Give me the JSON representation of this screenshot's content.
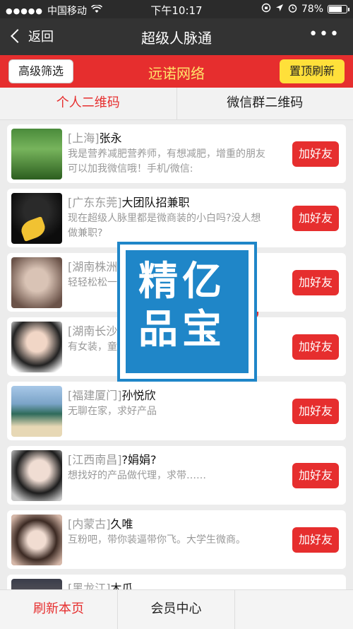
{
  "status_bar": {
    "carrier": "中国移动",
    "time": "下午10:17",
    "battery_percent": "78%",
    "battery_level": 0.78
  },
  "nav": {
    "back_label": "返回",
    "title": "超级人脉通",
    "more_label": "•••"
  },
  "header": {
    "filter_label": "高级筛选",
    "title": "远诺网络",
    "top_refresh_label": "置顶刷新"
  },
  "tabs": [
    {
      "label": "个人二维码",
      "active": true
    },
    {
      "label": "微信群二维码",
      "active": false
    }
  ],
  "list": {
    "add_label": "加好友",
    "items": [
      {
        "location": "[上海]",
        "name": "张永",
        "desc": "我是营养减肥营养师，有想减肥，增重的朋友可以加我微信哦！手机/微信:"
      },
      {
        "location": "[广东东莞]",
        "name": "大团队招兼职",
        "desc": "现在超级人脉里都是微商装的小白吗?没人想做兼职?"
      },
      {
        "location": "[湖南株洲",
        "name": "",
        "desc": "轻轻松松一"
      },
      {
        "location": "[湖南长沙",
        "name": "",
        "desc": "有女装，童"
      },
      {
        "location": "[福建厦门]",
        "name": "孙悦欣",
        "desc": "无聊在家，求好产品"
      },
      {
        "location": "[江西南昌]",
        "name": "?娟娟?",
        "desc": "想找好的产品做代理，求带……"
      },
      {
        "location": "[内蒙古]",
        "name": "久唯",
        "desc": "互粉吧，带你装逼带你飞。大学生微商。"
      },
      {
        "location": "[黑龙江]",
        "name": "木瓜",
        "desc": ""
      }
    ]
  },
  "watermark": {
    "text": "精亿品宝"
  },
  "bottom_bar": {
    "refresh_label": "刷新本页",
    "member_label": "会员中心"
  },
  "colors": {
    "accent_red": "#e62e2e",
    "highlight_yellow": "#ffe03a",
    "title_yellow": "#ffe36b",
    "watermark_blue": "#1f86c8"
  }
}
